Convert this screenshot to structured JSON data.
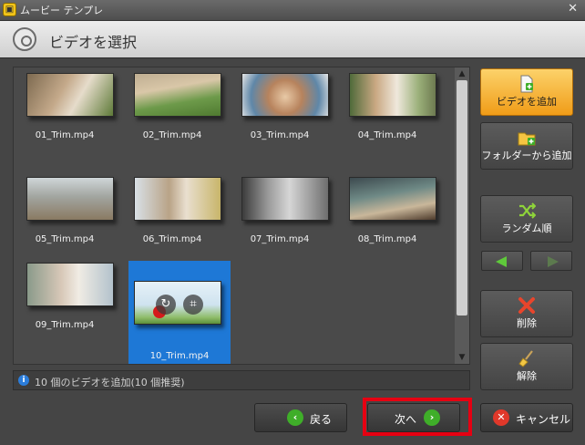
{
  "window": {
    "title": "ムービー テンプレ"
  },
  "header": {
    "title": "ビデオを選択"
  },
  "gallery": {
    "items": [
      {
        "name": "01_Trim.mp4"
      },
      {
        "name": "02_Trim.mp4"
      },
      {
        "name": "03_Trim.mp4"
      },
      {
        "name": "04_Trim.mp4"
      },
      {
        "name": "05_Trim.mp4"
      },
      {
        "name": "06_Trim.mp4"
      },
      {
        "name": "07_Trim.mp4"
      },
      {
        "name": "08_Trim.mp4"
      },
      {
        "name": "09_Trim.mp4"
      },
      {
        "name": "10_Trim.mp4",
        "selected": true
      }
    ]
  },
  "status": {
    "text": "10 個のビデオを追加(10 個推奨)"
  },
  "sidebar": {
    "add_video": "ビデオを追加",
    "add_from_folder": "フォルダーから追加",
    "random_order": "ランダム順",
    "delete": "削除",
    "clear": "解除"
  },
  "footer": {
    "back": "戻る",
    "next": "次へ",
    "cancel": "キャンセル"
  },
  "colors": {
    "accent_orange": "#f5a623",
    "selection_blue": "#1e78d6",
    "highlight_red": "#e60012",
    "nav_green": "#3fae29"
  }
}
